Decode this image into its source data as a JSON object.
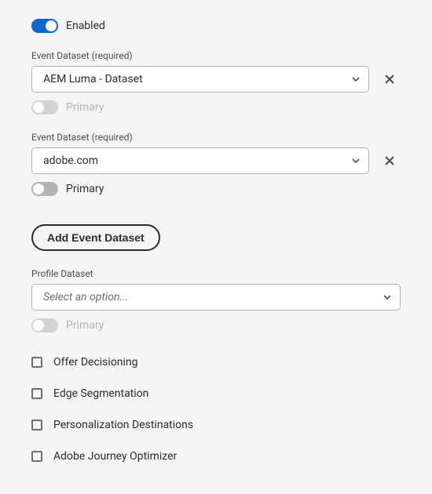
{
  "enabled": {
    "label": "Enabled",
    "on": true
  },
  "eventDatasets": [
    {
      "label": "Event Dataset (required)",
      "value": "AEM Luma - Dataset",
      "primaryLabel": "Primary",
      "primary": true,
      "primaryDisabled": true
    },
    {
      "label": "Event Dataset (required)",
      "value": "adobe.com",
      "primaryLabel": "Primary",
      "primary": false,
      "primaryDisabled": false
    }
  ],
  "addButton": {
    "label": "Add Event Dataset"
  },
  "profileDataset": {
    "label": "Profile Dataset",
    "placeholder": "Select an option...",
    "primaryLabel": "Primary",
    "primaryDisabled": true
  },
  "options": [
    {
      "label": "Offer Decisioning",
      "checked": false
    },
    {
      "label": "Edge Segmentation",
      "checked": false
    },
    {
      "label": "Personalization Destinations",
      "checked": false
    },
    {
      "label": "Adobe Journey Optimizer",
      "checked": false
    }
  ]
}
